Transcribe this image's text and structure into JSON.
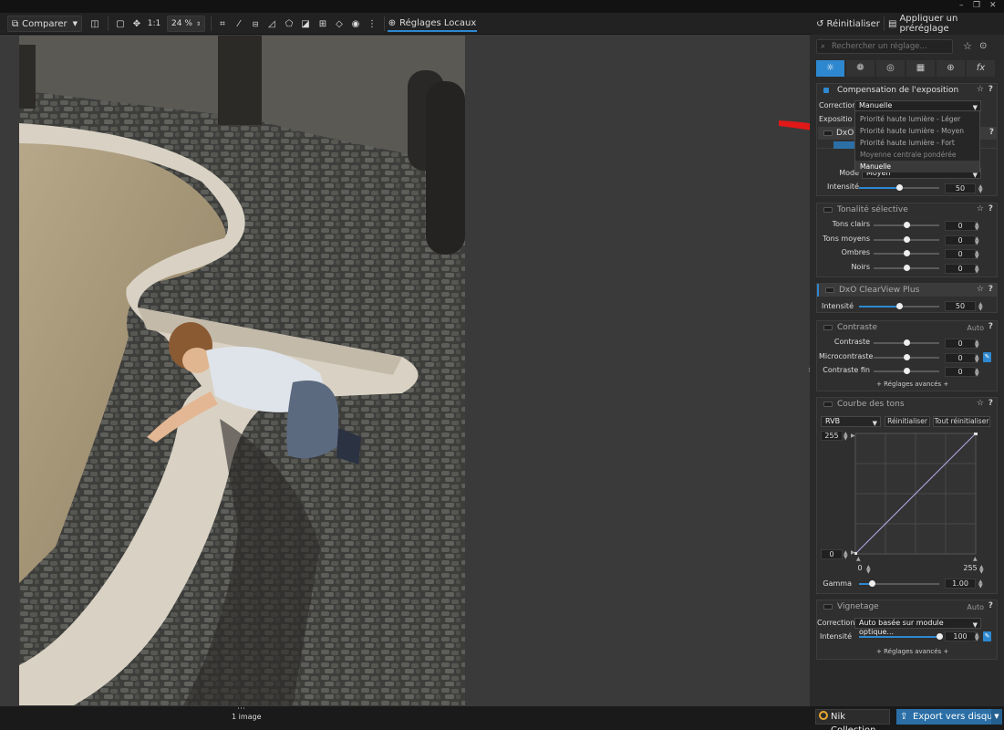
{
  "toolbar": {
    "compare_label": "Comparer",
    "zoom_1to1": "1:1",
    "zoom_value": "24 %",
    "local_adjust_label": "Réglages Locaux"
  },
  "header": {
    "reset_label": "Réinitialiser",
    "apply_preset_label": "Appliquer un préréglage"
  },
  "search": {
    "placeholder": "Rechercher un réglage..."
  },
  "tabs": [
    "light-icon",
    "color-icon",
    "detail-icon",
    "geometry-icon",
    "local-icon",
    "fx-icon"
  ],
  "exposure": {
    "title": "Compensation de l'exposition",
    "correction_label": "Correction",
    "correction_value": "Manuelle",
    "exposure_label": "Exposition",
    "menu": [
      "Priorité haute lumière - Léger",
      "Priorité haute lumière - Moyen",
      "Priorité haute lumière - Fort",
      "Moyenne centrale pondérée",
      "Manuelle"
    ]
  },
  "smart_lighting": {
    "title_partial": "DxO",
    "mode_label": "Mode",
    "mode_value": "Moyen",
    "intensity_label": "Intensité",
    "intensity_value": "50",
    "intensity_level": 0.5
  },
  "selective_tone": {
    "title": "Tonalité sélective",
    "rows": [
      {
        "label": "Tons clairs",
        "value": "0"
      },
      {
        "label": "Tons moyens",
        "value": "0"
      },
      {
        "label": "Ombres",
        "value": "0"
      },
      {
        "label": "Noirs",
        "value": "0"
      }
    ]
  },
  "clearview": {
    "title": "DxO ClearView Plus",
    "intensity_label": "Intensité",
    "intensity_value": "50",
    "intensity_level": 0.5
  },
  "contrast": {
    "title": "Contraste",
    "auto_label": "Auto",
    "rows": [
      {
        "label": "Contraste",
        "value": "0"
      },
      {
        "label": "Microcontraste",
        "value": "0"
      },
      {
        "label": "Contraste fin",
        "value": "0"
      }
    ],
    "advanced_label": "+ Réglages avancés +"
  },
  "tone_curve": {
    "title": "Courbe des tons",
    "channel_value": "RVB",
    "reset_label": "Réinitialiser",
    "reset_all_label": "Tout réinitialiser",
    "top_left_value": "255",
    "bottom_left_value": "0",
    "input_min_value": "0",
    "input_max_value": "255",
    "gamma_label": "Gamma",
    "gamma_value": "1.00"
  },
  "vignetting": {
    "title": "Vignetage",
    "auto_label": "Auto",
    "correction_label": "Correction",
    "correction_value": "Auto basée sur module optique...",
    "intensity_label": "Intensité",
    "intensity_value": "100",
    "intensity_level": 1.0,
    "advanced_label": "+ Réglages avancés +"
  },
  "bottom": {
    "image_count": "1 image",
    "nik_label": "Nik Collection",
    "export_label": "Export vers disque"
  },
  "colors": {
    "accent": "#2e88d0",
    "annotation_arrow": "#e01818"
  }
}
